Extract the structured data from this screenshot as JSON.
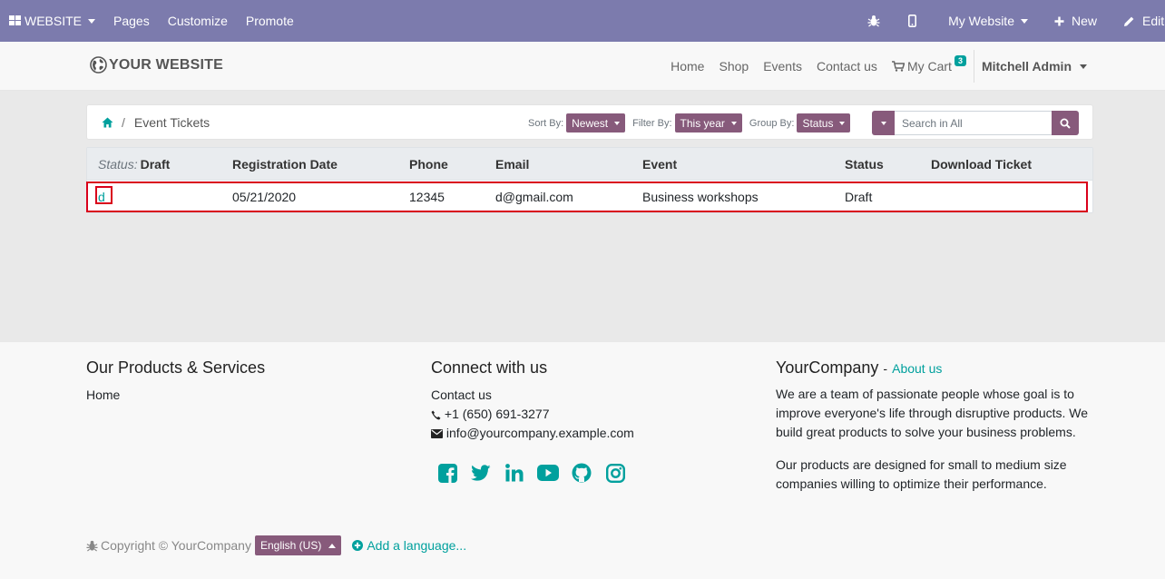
{
  "admin_bar": {
    "website_menu": "WEBSITE",
    "pages": "Pages",
    "customize": "Customize",
    "promote": "Promote",
    "my_website": "My Website",
    "new": "New",
    "edit": "Edit"
  },
  "header": {
    "logo_text": "YOUR WEBSITE",
    "nav": [
      "Home",
      "Shop",
      "Events",
      "Contact us"
    ],
    "cart_label": "My Cart",
    "cart_count": "3",
    "user": "Mitchell Admin"
  },
  "toolbar": {
    "breadcrumb_separator": "/",
    "breadcrumb_current": "Event Tickets",
    "sort_label": "Sort By:",
    "sort_value": "Newest",
    "filter_label": "Filter By:",
    "filter_value": "This year",
    "group_label": "Group By:",
    "group_value": "Status",
    "search_placeholder": "Search in All"
  },
  "table": {
    "group_label": "Status:",
    "group_value": "Draft",
    "columns": [
      "Registration Date",
      "Phone",
      "Email",
      "Event",
      "Status",
      "Download Ticket"
    ],
    "row": {
      "name": "d",
      "registration_date": "05/21/2020",
      "phone": "12345",
      "email": "d@gmail.com",
      "event": "Business workshops",
      "status": "Draft",
      "download_ticket": ""
    }
  },
  "footer": {
    "col1_title": "Our Products & Services",
    "col1_link": "Home",
    "col2_title": "Connect with us",
    "col2_contact": "Contact us",
    "phone": "+1 (650) 691-3277",
    "email": "info@yourcompany.example.com",
    "social_icons": [
      "facebook-icon",
      "twitter-icon",
      "linkedin-icon",
      "youtube-icon",
      "github-icon",
      "instagram-icon"
    ],
    "col3_company": "YourCompany",
    "col3_sep": "-",
    "col3_about": "About us",
    "col3_p1": "We are a team of passionate people whose goal is to improve everyone's life through disruptive products. We build great products to solve your business problems.",
    "col3_p2": "Our products are designed for small to medium size companies willing to optimize their performance.",
    "copyright": "Copyright © YourCompany",
    "language": "English (US)",
    "add_language": "Add a language..."
  },
  "colors": {
    "admin_bar": "#7c7bad",
    "brand": "#875a7b",
    "accent": "#00a09d",
    "highlight": "#d9001b"
  }
}
